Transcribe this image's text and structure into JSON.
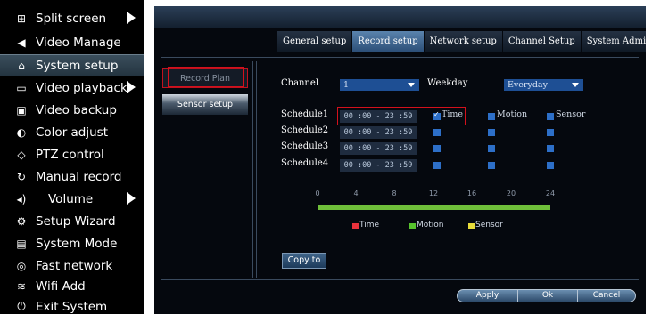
{
  "left_menu": {
    "items": [
      {
        "label": "Split screen",
        "icon": "⊞",
        "has_arrow": true
      },
      {
        "label": "Video Manage",
        "icon": "◀",
        "has_arrow": false
      },
      {
        "label": "System setup",
        "icon": "⌂",
        "has_arrow": false,
        "active": true
      },
      {
        "label": "Video playback",
        "icon": "▭",
        "has_arrow": true
      },
      {
        "label": "Video backup",
        "icon": "▣",
        "has_arrow": false
      },
      {
        "label": "Color adjust",
        "icon": "◐",
        "has_arrow": false
      },
      {
        "label": "PTZ control",
        "icon": "◇",
        "has_arrow": false
      },
      {
        "label": "Manual record",
        "icon": "↻",
        "has_arrow": false
      },
      {
        "label": "Volume",
        "icon": "◂)",
        "has_arrow": true
      },
      {
        "label": "Setup Wizard",
        "icon": "⚙",
        "has_arrow": false
      },
      {
        "label": "System Mode",
        "icon": "▤",
        "has_arrow": false
      },
      {
        "label": "Fast network",
        "icon": "◎",
        "has_arrow": false
      },
      {
        "label": "Wifi Add",
        "icon": "≋",
        "has_arrow": false
      },
      {
        "label": "Exit System",
        "icon": "⏻",
        "has_arrow": false
      }
    ]
  },
  "tabs": [
    {
      "label": "General setup"
    },
    {
      "label": "Record setup",
      "active": true
    },
    {
      "label": "Network setup"
    },
    {
      "label": "Channel Setup"
    },
    {
      "label": "System Admin"
    }
  ],
  "side_nav": {
    "record_plan": "Record Plan",
    "sensor_setup": "Sensor setup"
  },
  "form": {
    "channel_label": "Channel",
    "channel_value": "1",
    "weekday_label": "Weekday",
    "weekday_value": "Everyday"
  },
  "schedules": [
    {
      "label": "Schedule1",
      "time": "00 :00 - 23 :59",
      "time_checked": true,
      "motion_checked": false,
      "sensor_checked": false
    },
    {
      "label": "Schedule2",
      "time": "00 :00 - 23 :59",
      "time_checked": false,
      "motion_checked": false,
      "sensor_checked": false
    },
    {
      "label": "Schedule3",
      "time": "00 :00 - 23 :59",
      "time_checked": false,
      "motion_checked": false,
      "sensor_checked": false
    },
    {
      "label": "Schedule4",
      "time": "00 :00 - 23 :59",
      "time_checked": false,
      "motion_checked": false,
      "sensor_checked": false
    }
  ],
  "check_labels": {
    "time": "Time",
    "motion": "Motion",
    "sensor": "Sensor"
  },
  "timeline": {
    "ticks": [
      "0",
      "4",
      "8",
      "12",
      "16",
      "20",
      "24"
    ],
    "bar_start_hour": 0,
    "bar_end_hour": 24,
    "bar_color": "#6fbf3a"
  },
  "legend": [
    {
      "label": "Time",
      "color": "#e8323c"
    },
    {
      "label": "Motion",
      "color": "#57c22d"
    },
    {
      "label": "Sensor",
      "color": "#e8dc3a"
    }
  ],
  "buttons": {
    "copy_to": "Copy to",
    "apply": "Apply",
    "ok": "Ok",
    "cancel": "Cancel"
  }
}
